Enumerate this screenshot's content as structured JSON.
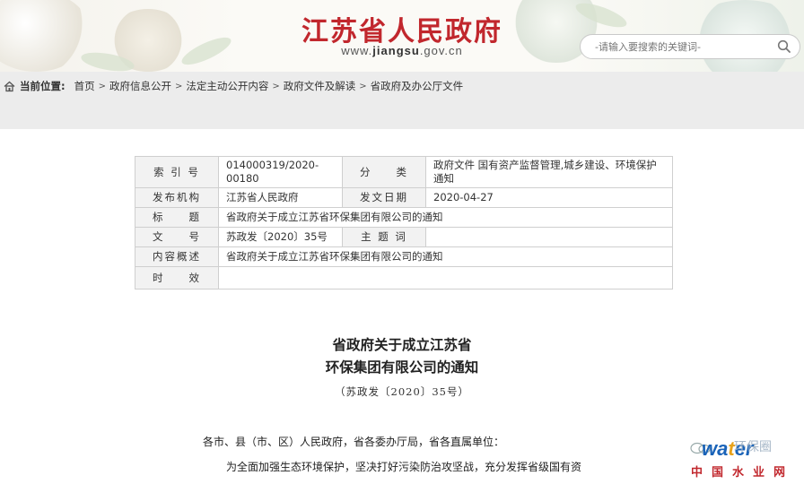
{
  "header": {
    "site_title": "江苏省人民政府",
    "url_prefix": "www.",
    "url_domain": "jiangsu",
    "url_suffix": ".gov.cn",
    "search_placeholder": "-请输入要搜索的关键词-",
    "search_icon": "search-icon"
  },
  "breadcrumb": {
    "label": "当前位置:",
    "items": [
      "首页",
      "政府信息公开",
      "法定主动公开内容",
      "政府文件及解读",
      "省政府及办公厅文件"
    ]
  },
  "meta": {
    "index_label": "索 引 号",
    "index_value": "014000319/2020-00180",
    "category_label": "分　　类",
    "category_value": "政府文件 国有资产监督管理,城乡建设、环境保护 通知",
    "publisher_label": "发布机构",
    "publisher_value": "江苏省人民政府",
    "date_label": "发文日期",
    "date_value": "2020-04-27",
    "title_label": "标　　题",
    "title_value": "省政府关于成立江苏省环保集团有限公司的通知",
    "docno_label": "文　　号",
    "docno_value": "苏政发〔2020〕35号",
    "subject_label": "主 题 词",
    "subject_value": "",
    "summary_label": "内容概述",
    "summary_value": "省政府关于成立江苏省环保集团有限公司的通知",
    "validity_label": "时　　效",
    "validity_value": ""
  },
  "document": {
    "title_line1": "省政府关于成立江苏省",
    "title_line2": "环保集团有限公司的通知",
    "number": "（苏政发〔2020〕35号）",
    "addressee": "各市、县（市、区）人民政府，省各委办厅局，省各直属单位：",
    "paragraph": "为全面加强生态环境保护，坚决打好污染防治攻坚战，充分发挥省级国有资"
  },
  "watermark": {
    "brand_w": "wa",
    "brand_o": "t",
    "brand_rest": "er",
    "suffix": "环保圈",
    "cn": "中国水业网"
  },
  "colors": {
    "title_red": "#c1272d",
    "watermark_blue": "#1a63b8"
  }
}
